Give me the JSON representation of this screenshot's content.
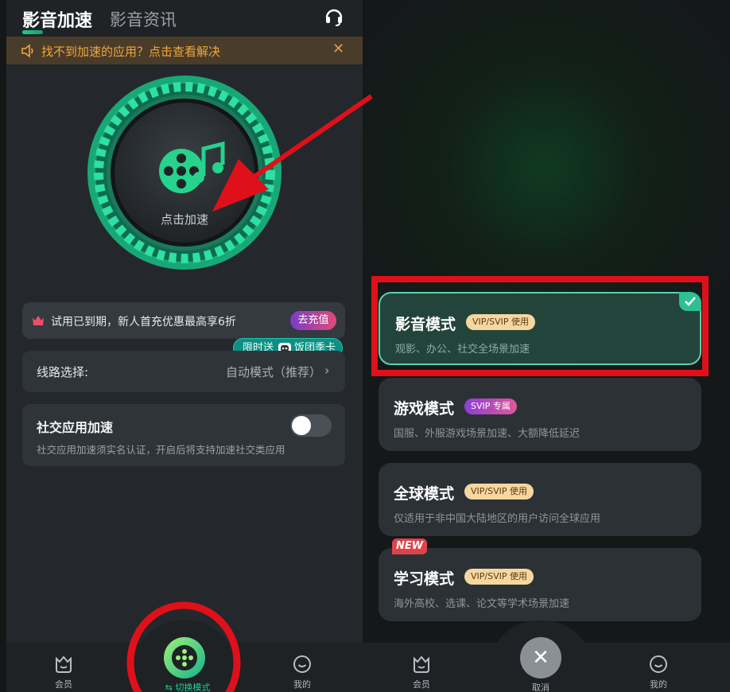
{
  "left": {
    "tabs": {
      "active": "影音加速",
      "inactive": "影音资讯"
    },
    "notice": {
      "text": "找不到加速的应用？点击查看解决",
      "close": "✕"
    },
    "accelerator": {
      "label": "点击加速"
    },
    "trial": {
      "text": "试用已到期，新人首充优惠最高享6折",
      "button": "去充值"
    },
    "promo": {
      "prefix": "限时送",
      "suffix": "饭团季卡"
    },
    "route": {
      "label": "线路选择:",
      "value": "自动模式（推荐）",
      "chevron": "›"
    },
    "social": {
      "title": "社交应用加速",
      "desc": "社交应用加速须实名认证，开启后将支持加速社交类应用",
      "enabled": false
    },
    "nav": {
      "member": "会员",
      "switch": "⇆ 切换模式",
      "mine": "我的"
    }
  },
  "right": {
    "modes": [
      {
        "name": "影音模式",
        "badge": "VIP/SVIP 使用",
        "badge_type": "vip",
        "desc": "观影、办公、社交全场景加速",
        "selected": true
      },
      {
        "name": "游戏模式",
        "badge": "SVIP 专属",
        "badge_type": "svip",
        "desc": "国服、外服游戏场景加速、大额降低延迟",
        "selected": false
      },
      {
        "name": "全球模式",
        "badge": "VIP/SVIP 使用",
        "badge_type": "vip",
        "desc": "仅适用于非中国大陆地区的用户访问全球应用",
        "selected": false
      },
      {
        "name": "学习模式",
        "badge": "VIP/SVIP 使用",
        "badge_type": "vip",
        "desc": "海外高校、选课、论文等学术场景加速",
        "selected": false
      }
    ],
    "new_tag": "NEW",
    "nav": {
      "member": "会员",
      "cancel": "取消",
      "mine": "我的"
    }
  },
  "colors": {
    "accent_green": "#1ed08f",
    "annotation_red": "#e0101a",
    "vip_badge": "#f6d7a0"
  }
}
